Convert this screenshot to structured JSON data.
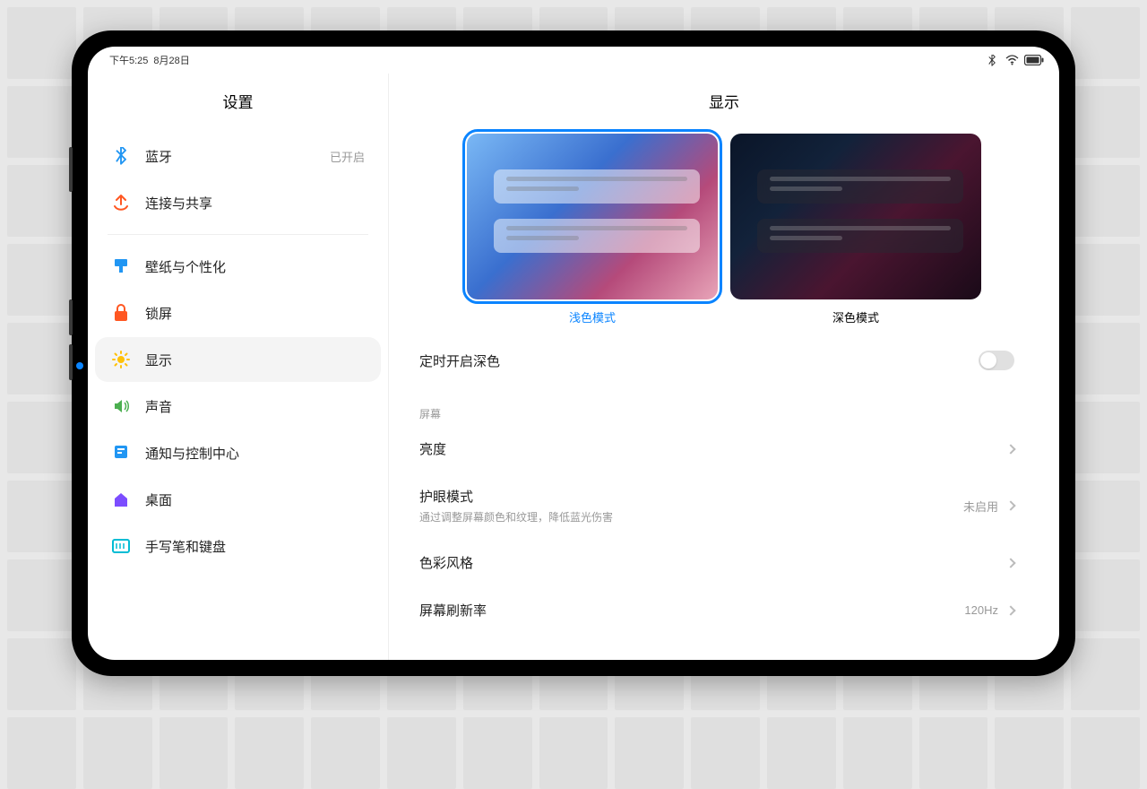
{
  "statusbar": {
    "time": "下午5:25",
    "date": "8月28日"
  },
  "sidebar": {
    "title": "设置",
    "items": [
      {
        "label": "蓝牙",
        "status": "已开启"
      },
      {
        "label": "连接与共享"
      },
      {
        "label": "壁纸与个性化"
      },
      {
        "label": "锁屏"
      },
      {
        "label": "显示"
      },
      {
        "label": "声音"
      },
      {
        "label": "通知与控制中心"
      },
      {
        "label": "桌面"
      },
      {
        "label": "手写笔和键盘"
      }
    ]
  },
  "main": {
    "title": "显示",
    "themes": {
      "light": "浅色模式",
      "dark": "深色模式"
    },
    "schedule_dark": "定时开启深色",
    "section_screen": "屏幕",
    "brightness": "亮度",
    "eye_protection": {
      "label": "护眼模式",
      "sub": "通过调整屏幕颜色和纹理，降低蓝光伤害",
      "status": "未启用"
    },
    "color_style": "色彩风格",
    "refresh_rate": {
      "label": "屏幕刷新率",
      "value": "120Hz"
    }
  }
}
